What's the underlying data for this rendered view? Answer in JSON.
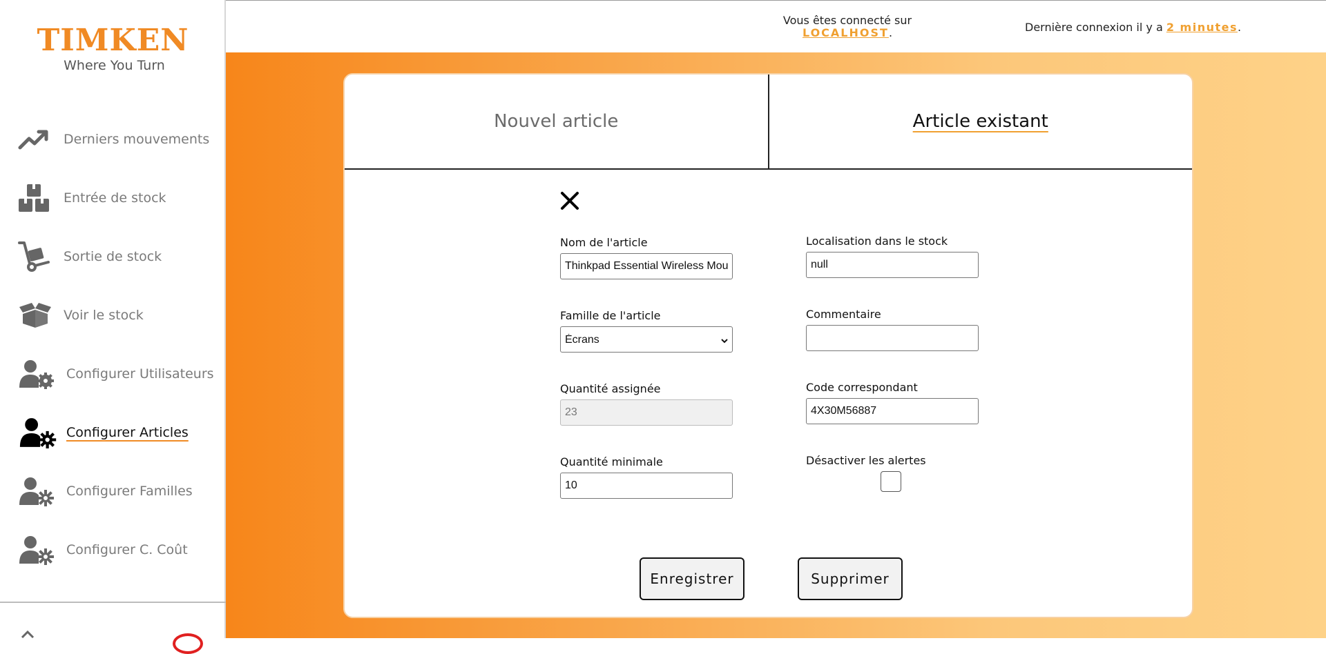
{
  "logo": {
    "brand": "TIMKEN",
    "tagline": "Where You Turn"
  },
  "sidebar": {
    "items": [
      {
        "label": "Derniers mouvements",
        "icon": "trending-up-icon",
        "active": false
      },
      {
        "label": "Entrée de stock",
        "icon": "boxes-stack-icon",
        "active": false
      },
      {
        "label": "Sortie de stock",
        "icon": "hand-truck-icon",
        "active": false
      },
      {
        "label": "Voir le stock",
        "icon": "open-box-icon",
        "active": false
      },
      {
        "label": "Configurer Utilisateurs",
        "icon": "user-gear-icon",
        "active": false
      },
      {
        "label": "Configurer Articles",
        "icon": "user-gear-icon",
        "active": true
      },
      {
        "label": "Configurer Familles",
        "icon": "user-gear-icon",
        "active": false
      },
      {
        "label": "Configurer C. Coût",
        "icon": "user-gear-icon",
        "active": false
      }
    ]
  },
  "header": {
    "connected_prefix": "Vous êtes connecté sur",
    "host": "LOCALHOST",
    "host_suffix": ".",
    "last_login_prefix": "Dernière connexion il y a",
    "last_login_value": "2 minutes",
    "last_login_suffix": "."
  },
  "tabs": [
    {
      "label": "Nouvel article",
      "active": false
    },
    {
      "label": "Article existant",
      "active": true
    }
  ],
  "form": {
    "name": {
      "label": "Nom de l'article",
      "value": "Thinkpad Essential Wireless Mouse"
    },
    "family": {
      "label": "Famille de l'article",
      "selected": "Écrans"
    },
    "assigned_qty": {
      "label": "Quantité assignée",
      "value": "23"
    },
    "min_qty": {
      "label": "Quantité minimale",
      "value": "10"
    },
    "location": {
      "label": "Localisation dans le stock",
      "value": "null"
    },
    "comment": {
      "label": "Commentaire",
      "value": ""
    },
    "code": {
      "label": "Code correspondant",
      "value": "4X30M56887"
    },
    "disable_alerts": {
      "label": "Désactiver les alertes",
      "checked": false
    }
  },
  "buttons": {
    "save": "Enregistrer",
    "delete": "Supprimer"
  },
  "colors": {
    "accent": "#f08a24",
    "link": "#f0a030",
    "gradient_start": "#f7861a",
    "gradient_end": "#fed288"
  }
}
